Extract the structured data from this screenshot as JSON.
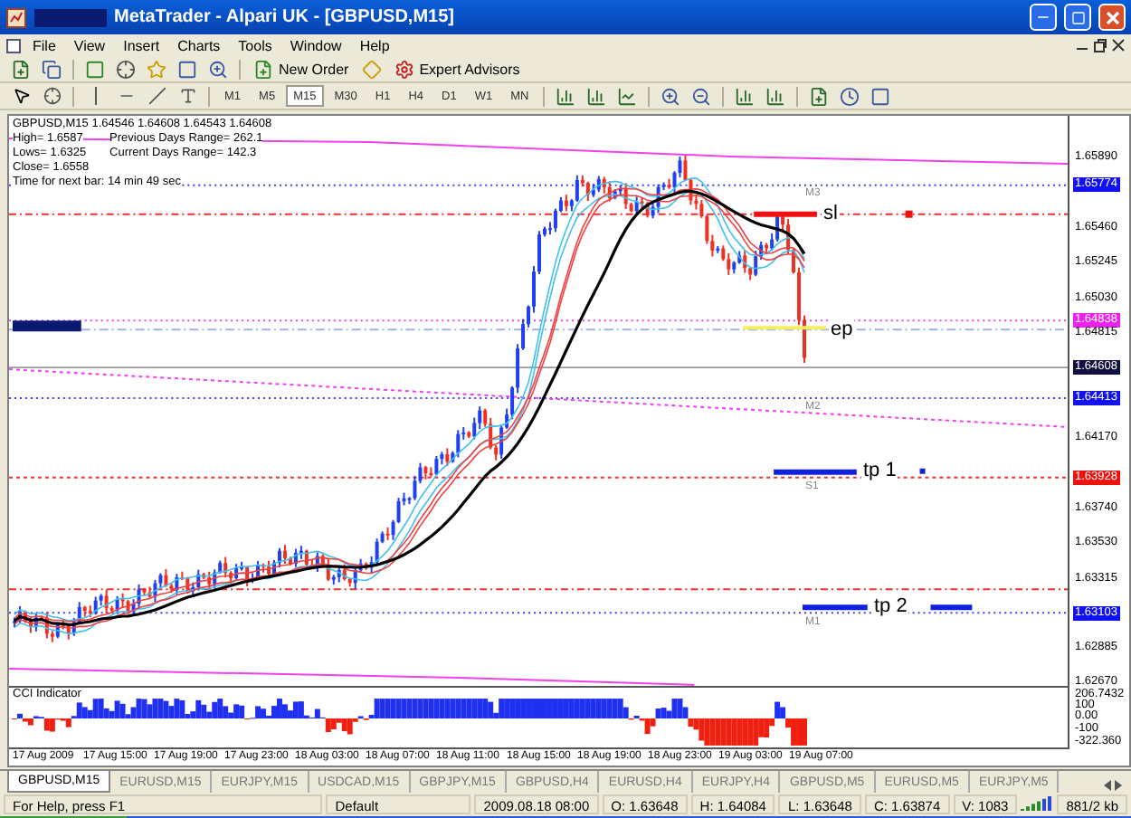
{
  "window": {
    "title": "MetaTrader - Alpari UK - [GBPUSD,M15]"
  },
  "menu": [
    "File",
    "View",
    "Insert",
    "Charts",
    "Tools",
    "Window",
    "Help"
  ],
  "toolbar_buttons": [
    "New Order",
    "Expert Advisors"
  ],
  "timeframes": [
    {
      "label": "M1",
      "selected": false
    },
    {
      "label": "M5",
      "selected": false
    },
    {
      "label": "M15",
      "selected": true
    },
    {
      "label": "M30",
      "selected": false
    },
    {
      "label": "H1",
      "selected": false
    },
    {
      "label": "H4",
      "selected": false
    },
    {
      "label": "D1",
      "selected": false
    },
    {
      "label": "W1",
      "selected": false
    },
    {
      "label": "MN",
      "selected": false
    }
  ],
  "chart": {
    "header": "GBPUSD,M15  1.64546 1.64608 1.64543 1.64608",
    "info": [
      {
        "left": "High= 1.6587",
        "right": "Previous Days Range= 262.1"
      },
      {
        "left": "Lows= 1.6325",
        "right": "Current Days Range= 142.3"
      },
      {
        "left": "Close= 1.6558"
      },
      {
        "left": "Time for next bar: 14 min 49 sec"
      }
    ],
    "levels": [
      "M3",
      "M2",
      "S1",
      "M1"
    ],
    "annotations": [
      "sl",
      "ep",
      "tp 1",
      "tp 2"
    ],
    "price_labels": [
      {
        "text": "1.65890",
        "kind": "plain"
      },
      {
        "text": "1.65774",
        "kind": "marker",
        "color": "#1010f0"
      },
      {
        "text": "1.65460",
        "kind": "plain"
      },
      {
        "text": "1.65245",
        "kind": "plain"
      },
      {
        "text": "1.65030",
        "kind": "plain"
      },
      {
        "text": "1.64838",
        "kind": "marker",
        "color": "#f020f0"
      },
      {
        "text": "1.64815",
        "kind": "plain"
      },
      {
        "text": "1.64608",
        "kind": "marker",
        "color": "#101040"
      },
      {
        "text": "1.64413",
        "kind": "marker",
        "color": "#1010f0"
      },
      {
        "text": "1.64170",
        "kind": "plain"
      },
      {
        "text": "1.63928",
        "kind": "marker",
        "color": "#f01010"
      },
      {
        "text": "1.63740",
        "kind": "plain"
      },
      {
        "text": "1.63530",
        "kind": "plain"
      },
      {
        "text": "1.63315",
        "kind": "plain"
      },
      {
        "text": "1.63103",
        "kind": "marker",
        "color": "#1010f0"
      },
      {
        "text": "1.62885",
        "kind": "plain"
      },
      {
        "text": "1.62670",
        "kind": "plain"
      }
    ],
    "indicator": {
      "title": "CCI Indicator",
      "scale": [
        "206.7432",
        "100",
        "0.00",
        "-100",
        "-322.360"
      ]
    },
    "time_labels": [
      "17 Aug 2009",
      "17 Aug 15:00",
      "17 Aug 19:00",
      "17 Aug 23:00",
      "18 Aug 03:00",
      "18 Aug 07:00",
      "18 Aug 11:00",
      "18 Aug 15:00",
      "18 Aug 19:00",
      "18 Aug 23:00",
      "19 Aug 03:00",
      "19 Aug 07:00"
    ]
  },
  "tabs": [
    {
      "label": "GBPUSD,M15",
      "selected": true
    },
    {
      "label": "EURUSD,M15",
      "selected": false
    },
    {
      "label": "EURJPY,M15",
      "selected": false
    },
    {
      "label": "USDCAD,M15",
      "selected": false
    },
    {
      "label": "GBPJPY,M15",
      "selected": false
    },
    {
      "label": "GBPUSD,H4",
      "selected": false
    },
    {
      "label": "EURUSD,H4",
      "selected": false
    },
    {
      "label": "EURJPY,H4",
      "selected": false
    },
    {
      "label": "GBPUSD,M5",
      "selected": false
    },
    {
      "label": "EURUSD,M5",
      "selected": false
    },
    {
      "label": "EURJPY,M5",
      "selected": false
    }
  ],
  "status_bar": [
    "For Help, press F1",
    "Default",
    "2009.08.18 08:00",
    "O: 1.63648",
    "H: 1.64084",
    "L: 1.63648",
    "C: 1.63874",
    "V: 1083",
    "881/2 kb"
  ]
}
